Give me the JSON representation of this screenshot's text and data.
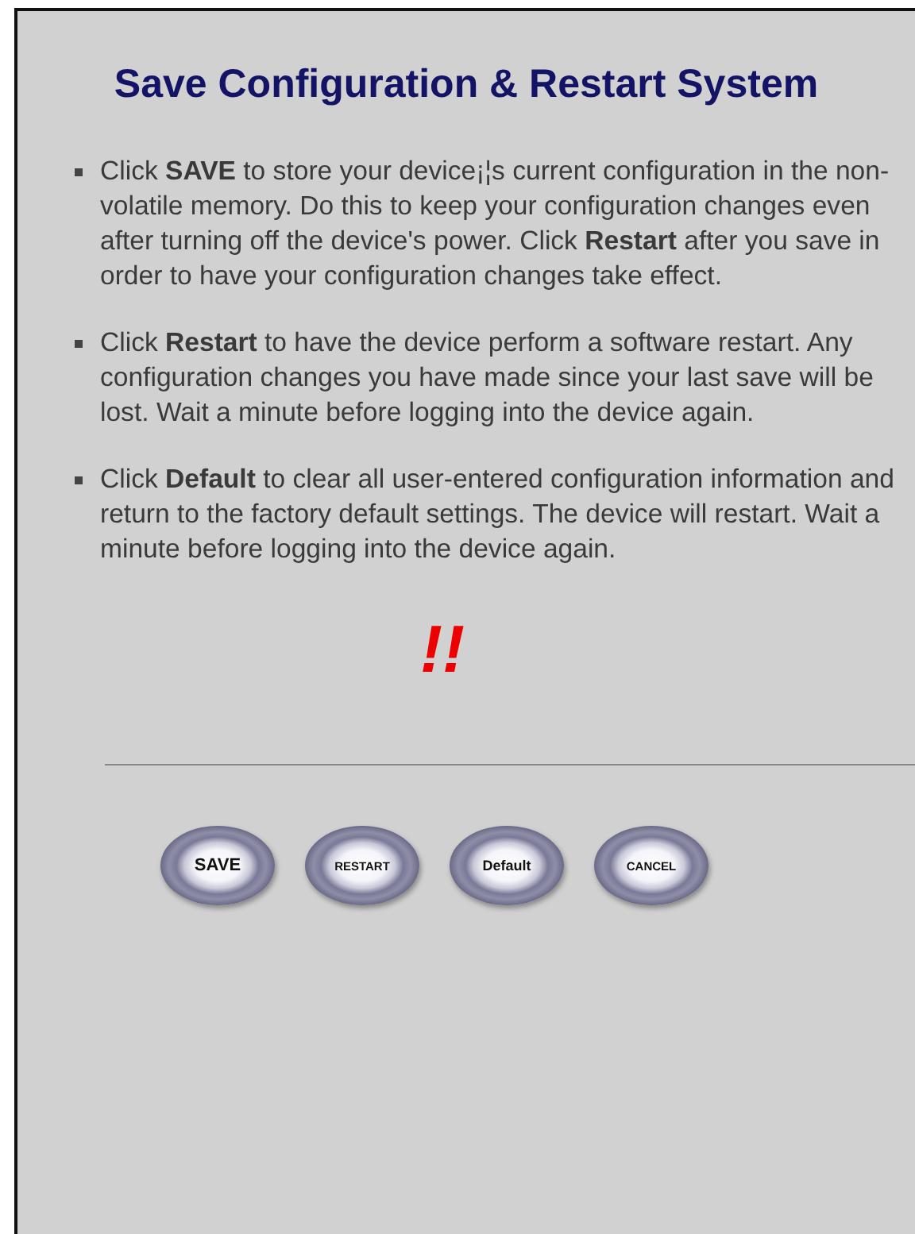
{
  "title": "Save Configuration & Restart System",
  "items": [
    "Click **SAVE** to store your device¡¦s current configuration in the non-volatile memory. Do this to keep your configuration changes even after turning off the device's power. Click **Restart** after you save in order to have your configuration changes take effect.",
    "Click **Restart** to have the device perform a software restart. Any configuration changes you have made since your last save will be lost. Wait a minute before logging into the device again.",
    "Click **Default** to clear all user-entered configuration information and return to the factory default settings. The device will restart. Wait a minute before logging into the device again."
  ],
  "warning": "!!",
  "buttons": [
    {
      "label": "SAVE",
      "kind": "large"
    },
    {
      "label": "RESTART",
      "kind": "small"
    },
    {
      "label": "Default",
      "kind": "medium"
    },
    {
      "label": "CANCEL",
      "kind": "small"
    }
  ]
}
